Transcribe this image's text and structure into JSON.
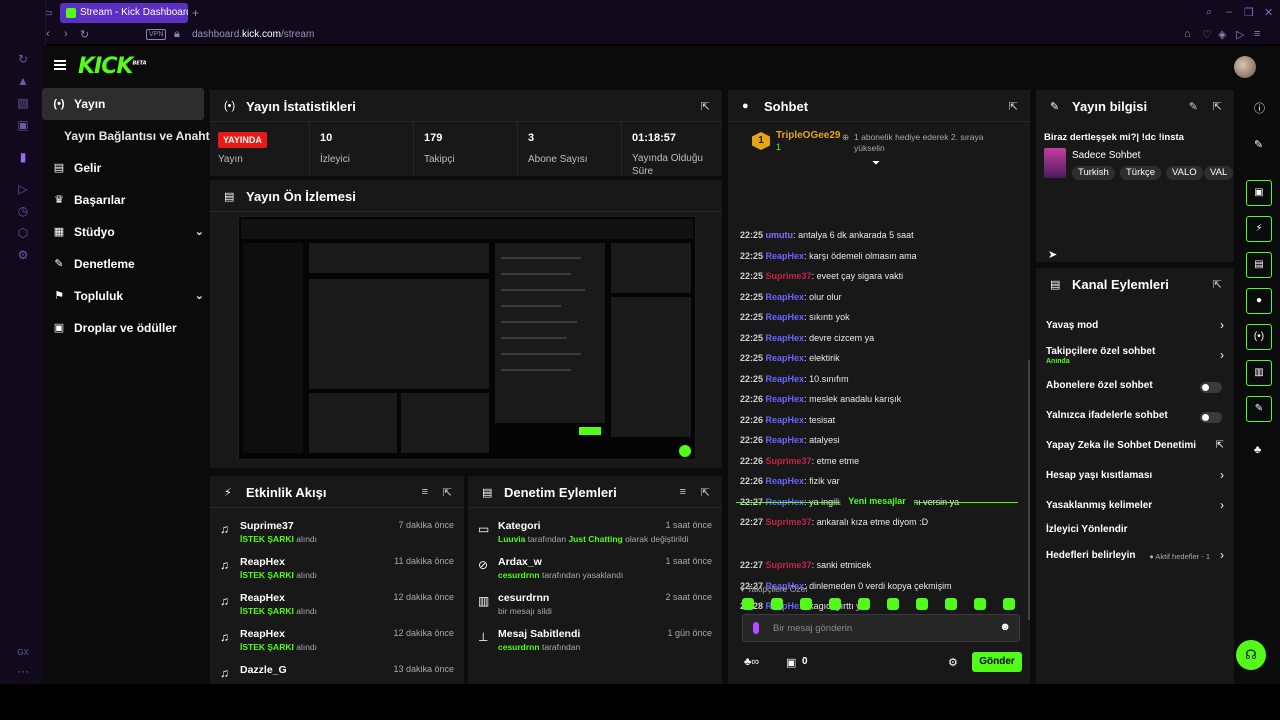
{
  "browser": {
    "tab_title": "Stream - Kick Dashboard",
    "url_prefix": "dashboard.",
    "url_domain": "kick.com",
    "url_path": "/stream",
    "vpn_label": "VPN",
    "bottom_label": "GX"
  },
  "app": {
    "logo": "KICK",
    "logo_badge": "BETA"
  },
  "nav": {
    "items": [
      {
        "label": "Yayın",
        "icon": "broadcast-icon",
        "glyph": "(•)"
      },
      {
        "label": "Yayın Bağlantısı ve Anahtarı",
        "sub": true
      },
      {
        "label": "Gelir",
        "icon": "revenue-icon",
        "glyph": "▤"
      },
      {
        "label": "Başarılar",
        "icon": "trophy-icon",
        "glyph": "♛"
      },
      {
        "label": "Stüdyo",
        "icon": "studio-icon",
        "glyph": "▦",
        "chevron": "⌄"
      },
      {
        "label": "Denetleme",
        "icon": "wrench-icon",
        "glyph": "✎"
      },
      {
        "label": "Topluluk",
        "icon": "community-icon",
        "glyph": "⚑",
        "chevron": "⌄"
      },
      {
        "label": "Droplar ve ödüller",
        "icon": "gift-icon",
        "glyph": "▣"
      }
    ]
  },
  "stats": {
    "title": "Yayın İstatistikleri",
    "live_badge": "YAYINDA",
    "live_label": "Yayın",
    "cells": [
      {
        "value": "10",
        "label": "İzleyici"
      },
      {
        "value": "179",
        "label": "Takipçi"
      },
      {
        "value": "3",
        "label": "Abone Sayısı"
      },
      {
        "value": "01:18:57",
        "label": "Yayında Olduğu Süre"
      }
    ]
  },
  "preview": {
    "title": "Yayın Ön İzlemesi"
  },
  "activity": {
    "title": "Etkinlik Akışı",
    "items": [
      {
        "name": "Suprime37",
        "tag": "İSTEK ŞARKI",
        "suffix": "alındı",
        "time": "7 dakika önce"
      },
      {
        "name": "ReapHex",
        "tag": "İSTEK ŞARKI",
        "suffix": "alındı",
        "time": "11 dakika önce"
      },
      {
        "name": "ReapHex",
        "tag": "İSTEK ŞARKI",
        "suffix": "alındı",
        "time": "12 dakika önce"
      },
      {
        "name": "ReapHex",
        "tag": "İSTEK ŞARKI",
        "suffix": "alındı",
        "time": "12 dakika önce"
      },
      {
        "name": "Dazzle_G",
        "tag": "",
        "suffix": "",
        "time": "13 dakika önce"
      }
    ]
  },
  "moderation": {
    "title": "Denetim Eylemleri",
    "items": [
      {
        "name": "Kategori",
        "actor": "Luuvia",
        "mid": "tarafından",
        "target": "Just Chatting",
        "tail": "olarak değiştirildi",
        "time": "1 saat önce",
        "icon": "category-icon",
        "glyph": "▭"
      },
      {
        "name": "Ardax_w",
        "actor": "cesurdrnn",
        "mid": "tarafından yasaklandı",
        "target": "",
        "tail": "",
        "time": "1 saat önce",
        "icon": "ban-icon",
        "glyph": "⊘"
      },
      {
        "name": "cesurdrnn",
        "actor": "",
        "mid": "bir mesajı sildi",
        "target": "",
        "tail": "",
        "time": "2 saat önce",
        "icon": "trash-icon",
        "glyph": "▥"
      },
      {
        "name": "Mesaj Sabitlendi",
        "actor": "cesurdrnn",
        "mid": "tarafından",
        "target": "",
        "tail": "",
        "time": "1 gün önce",
        "icon": "pin-icon",
        "glyph": "⊥"
      }
    ]
  },
  "chat": {
    "title": "Sohbet",
    "top_user": "TripleOGee29",
    "top_rank": "1",
    "top_count": "1",
    "top_msg": "1 abonelik hediye ederek 2. sıraya yükselin",
    "messages": [
      {
        "time": "22:25",
        "user": "umutu",
        "color": "#8a6cff",
        "text": "antalya 6 dk ankarada 5 saat"
      },
      {
        "time": "22:25",
        "user": "ReapHex",
        "color": "#6c63ff",
        "text": "karşı ödemeli olmasın ama"
      },
      {
        "time": "22:25",
        "user": "Suprime37",
        "color": "#c7224a",
        "text": "eveet çay sigara vakti"
      },
      {
        "time": "22:25",
        "user": "ReapHex",
        "color": "#6c63ff",
        "text": "olur olur"
      },
      {
        "time": "22:25",
        "user": "ReapHex",
        "color": "#6c63ff",
        "text": "sıkıntı yok"
      },
      {
        "time": "22:25",
        "user": "ReapHex",
        "color": "#6c63ff",
        "text": "devre cizcem ya"
      },
      {
        "time": "22:25",
        "user": "ReapHex",
        "color": "#6c63ff",
        "text": "elektirik"
      },
      {
        "time": "22:25",
        "user": "ReapHex",
        "color": "#6c63ff",
        "text": "10.sınıfım"
      },
      {
        "time": "22:26",
        "user": "ReapHex",
        "color": "#6c63ff",
        "text": "meslek anadalu karışık"
      },
      {
        "time": "22:26",
        "user": "ReapHex",
        "color": "#6c63ff",
        "text": "tesisat"
      },
      {
        "time": "22:26",
        "user": "ReapHex",
        "color": "#6c63ff",
        "text": "atalyesi"
      },
      {
        "time": "22:26",
        "user": "Suprime37",
        "color": "#c7224a",
        "text": "etme etme"
      },
      {
        "time": "22:26",
        "user": "ReapHex",
        "color": "#6c63ff",
        "text": "fizik var"
      },
      {
        "time": "22:27",
        "user": "ReapHex",
        "color": "#6c63ff",
        "text": "ya ingilizcenin allah belasını versin ya"
      },
      {
        "time": "22:27",
        "user": "Suprime37",
        "color": "#c7224a",
        "text": "ankaralı kıza etme diyom :D"
      }
    ],
    "new_messages_label": "Yeni mesajlar",
    "new_messages": [
      {
        "time": "22:27",
        "user": "Suprime37",
        "color": "#c7224a",
        "text": "sanki etmicek"
      },
      {
        "time": "22:27",
        "user": "ReapHex",
        "color": "#6c63ff",
        "text": "dinlemeden 0 verdi kopya çekmişim"
      },
      {
        "time": "22:28",
        "user": "ReapHex",
        "color": "#6c63ff",
        "text": "kagıdı yırttı ya"
      }
    ],
    "followers_only": "♥ Takipçilere Özel",
    "input_placeholder": "Bir mesaj gönderin",
    "points_value": "0",
    "send_label": "Gönder"
  },
  "stream_info": {
    "title": "Yayın bilgisi",
    "stream_title": "Biraz dertleşşek mi?| !dc !insta",
    "category": "Sadece Sohbet",
    "tags": [
      "Turkish",
      "Türkçe",
      "VALO",
      "VAL"
    ]
  },
  "channel_actions": {
    "title": "Kanal Eylemleri",
    "items": [
      {
        "label": "Yavaş mod",
        "sub": "",
        "control": "chevron"
      },
      {
        "label": "Takipçilere özel sohbet",
        "sub": "Anında",
        "control": "chevron"
      },
      {
        "label": "Abonelere özel sohbet",
        "sub": "",
        "control": "toggle"
      },
      {
        "label": "Yalnızca ifadelerle sohbet",
        "sub": "",
        "control": "toggle"
      },
      {
        "label": "Yapay Zeka ile Sohbet Denetimi",
        "sub": "",
        "control": "external"
      },
      {
        "label": "Hesap yaşı kısıtlaması",
        "sub": "",
        "control": "chevron"
      },
      {
        "label": "Yasaklanmış kelimeler",
        "sub": "",
        "control": "chevron"
      },
      {
        "label": "İzleyici Yönlendir",
        "sub": "",
        "control": "none"
      },
      {
        "label": "Hedefleri belirleyin",
        "sub": "",
        "control": "chevron",
        "extra": "● Aktif hedefler - 1"
      }
    ]
  },
  "colors": {
    "accent": "#53fc18",
    "live": "#e91916",
    "panel": "#181818",
    "browser_tab": "#5a2fc2"
  }
}
